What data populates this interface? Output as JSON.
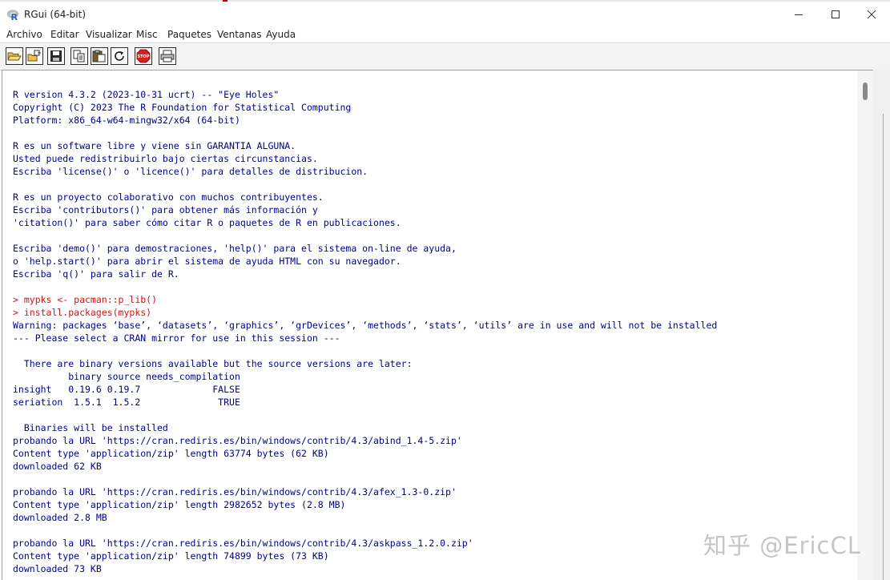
{
  "window": {
    "title": "RGui (64-bit)",
    "app_icon": "r-logo-icon",
    "controls": [
      "minimize-icon",
      "maximize-icon",
      "close-icon"
    ]
  },
  "menu": [
    "Archivo",
    "Editar",
    "Visualizar",
    "Misc",
    "Paquetes",
    "Ventanas",
    "Ayuda"
  ],
  "toolbar": {
    "buttons": [
      {
        "icon": "open-script-icon"
      },
      {
        "icon": "load-workspace-icon"
      },
      {
        "icon": "save-workspace-icon"
      },
      {
        "icon": "copy-icon"
      },
      {
        "icon": "paste-icon"
      },
      {
        "icon": "copy-paste-icon"
      },
      {
        "icon": "stop-icon",
        "label": "STOP"
      },
      {
        "icon": "print-icon"
      }
    ]
  },
  "colors": {
    "output": "#00008b",
    "input": "#d01515",
    "background": "#ffffff"
  },
  "console": {
    "lines": [
      {
        "text": "R version 4.3.2 (2023-10-31 ucrt) -- \"Eye Holes\"",
        "type": "output"
      },
      {
        "text": "Copyright (C) 2023 The R Foundation for Statistical Computing",
        "type": "output"
      },
      {
        "text": "Platform: x86_64-w64-mingw32/x64 (64-bit)",
        "type": "output"
      },
      {
        "text": "",
        "type": "output"
      },
      {
        "text": "R es un software libre y viene sin GARANTIA ALGUNA.",
        "type": "output"
      },
      {
        "text": "Usted puede redistribuirlo bajo ciertas circunstancias.",
        "type": "output"
      },
      {
        "text": "Escriba 'license()' o 'licence()' para detalles de distribucion.",
        "type": "output"
      },
      {
        "text": "",
        "type": "output"
      },
      {
        "text": "R es un proyecto colaborativo con muchos contribuyentes.",
        "type": "output"
      },
      {
        "text": "Escriba 'contributors()' para obtener más información y",
        "type": "output"
      },
      {
        "text": "'citation()' para saber cómo citar R o paquetes de R en publicaciones.",
        "type": "output"
      },
      {
        "text": "",
        "type": "output"
      },
      {
        "text": "Escriba 'demo()' para demostraciones, 'help()' para el sistema on-line de ayuda,",
        "type": "output"
      },
      {
        "text": "o 'help.start()' para abrir el sistema de ayuda HTML con su navegador.",
        "type": "output"
      },
      {
        "text": "Escriba 'q()' para salir de R.",
        "type": "output"
      },
      {
        "text": "",
        "type": "output"
      },
      {
        "text": "> mypks <- pacman::p_lib()",
        "type": "input"
      },
      {
        "text": "> install.packages(mypks)",
        "type": "input"
      },
      {
        "text": "Warning: packages ‘base’, ‘datasets’, ‘graphics’, ‘grDevices’, ‘methods’, ‘stats’, ‘utils’ are in use and will not be installed",
        "type": "output"
      },
      {
        "text": "--- Please select a CRAN mirror for use in this session ---",
        "type": "output"
      },
      {
        "text": "",
        "type": "output"
      },
      {
        "text": "  There are binary versions available but the source versions are later:",
        "type": "output"
      },
      {
        "text": "          binary source needs_compilation",
        "type": "output"
      },
      {
        "text": "insight   0.19.6 0.19.7             FALSE",
        "type": "output"
      },
      {
        "text": "seriation  1.5.1  1.5.2              TRUE",
        "type": "output"
      },
      {
        "text": "",
        "type": "output"
      },
      {
        "text": "  Binaries will be installed",
        "type": "output"
      },
      {
        "text": "probando la URL 'https://cran.rediris.es/bin/windows/contrib/4.3/abind_1.4-5.zip'",
        "type": "output"
      },
      {
        "text": "Content type 'application/zip' length 63774 bytes (62 KB)",
        "type": "output"
      },
      {
        "text": "downloaded 62 KB",
        "type": "output"
      },
      {
        "text": "",
        "type": "output"
      },
      {
        "text": "probando la URL 'https://cran.rediris.es/bin/windows/contrib/4.3/afex_1.3-0.zip'",
        "type": "output"
      },
      {
        "text": "Content type 'application/zip' length 2982652 bytes (2.8 MB)",
        "type": "output"
      },
      {
        "text": "downloaded 2.8 MB",
        "type": "output"
      },
      {
        "text": "",
        "type": "output"
      },
      {
        "text": "probando la URL 'https://cran.rediris.es/bin/windows/contrib/4.3/askpass_1.2.0.zip'",
        "type": "output"
      },
      {
        "text": "Content type 'application/zip' length 74899 bytes (73 KB)",
        "type": "output"
      },
      {
        "text": "downloaded 73 KB",
        "type": "output"
      }
    ]
  },
  "watermark": "知乎 @EricCL"
}
